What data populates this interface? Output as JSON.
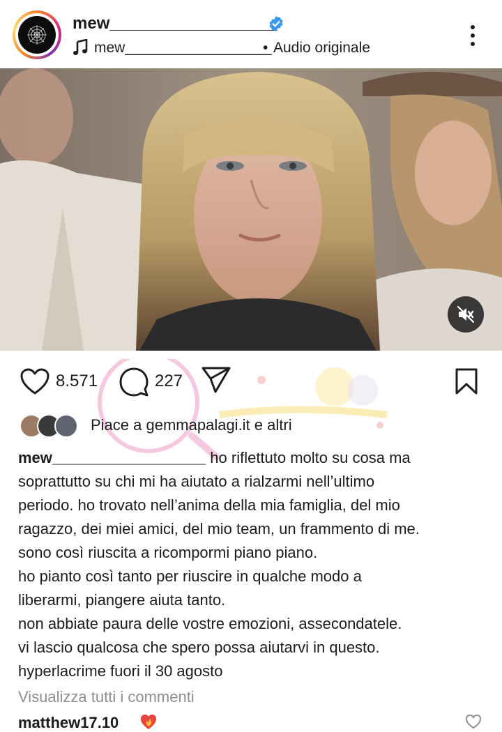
{
  "post": {
    "username": "mew__________________",
    "verified": true,
    "audio_user": "mew__________________",
    "audio_separator": "•",
    "audio_label": "Audio originale",
    "likes": "8.571",
    "comments": "227",
    "liked_by": "Piace a gemmapalagi.it e altri",
    "caption_user": "mew__________________",
    "caption_lines": [
      "ho riflettuto molto su cosa ma",
      "soprattutto su chi mi ha aiutato a rialzarmi nell’ultimo",
      "periodo. ho trovato nell’anima della mia famiglia, del mio",
      "ragazzo, dei miei amici, del mio team, un frammento di me.",
      "sono così riuscita a ricompormi piano piano.",
      "ho pianto così tanto per riuscire in qualche modo a",
      "liberarmi, piangere aiuta tanto.",
      "non abbiate paura delle vostre emozioni, assecondatele.",
      "vi lascio qualcosa che spero possa aiutarvi in questo.",
      "hyperlacrime fuori il 30 agosto"
    ],
    "view_comments": "Visualizza tutti i commenti",
    "top_comment_user": "matthew17.10"
  },
  "colors": {
    "text": "#1c1c1c",
    "muted": "#8e8e8e",
    "verified_blue": "#3897f0",
    "background": "#ffffff"
  },
  "icons": [
    "music-note-icon",
    "verified-badge-icon",
    "more-options-icon",
    "mute-icon",
    "heart-icon",
    "comment-icon",
    "share-icon",
    "bookmark-icon",
    "heart-fire-emoji",
    "comment-like-icon"
  ]
}
